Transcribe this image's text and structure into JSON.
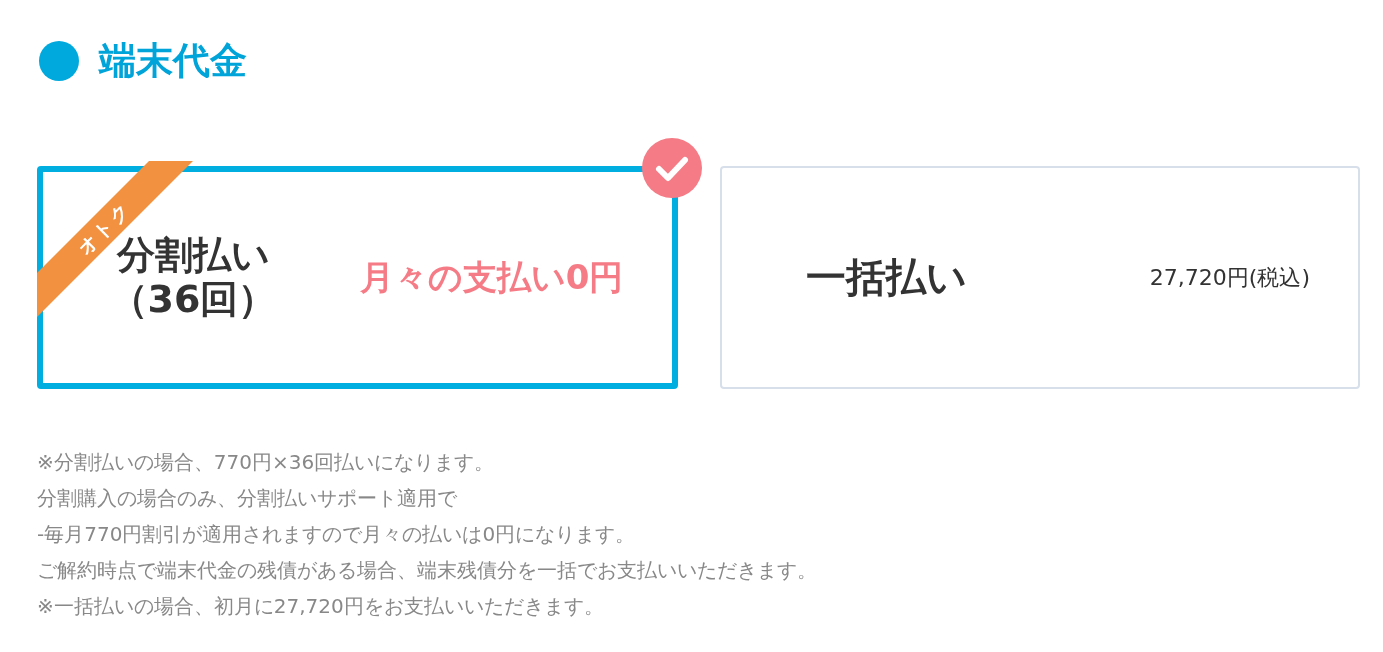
{
  "section": {
    "title": "端末代金"
  },
  "options": [
    {
      "label_lines": [
        "分割払い",
        "（36回）"
      ],
      "badge": "オトク",
      "price": "月々の支払い0円",
      "kind": "highlight",
      "selected": true
    },
    {
      "label_lines": [
        "一括払い"
      ],
      "price": "27,720円(税込)",
      "kind": "plain",
      "selected": false
    }
  ],
  "notes": [
    "※分割払いの場合、770円×36回払いになります。",
    "分割購入の場合のみ、分割払いサポート適用で",
    "‐毎月770円割引が適用されますので月々の払いは0円になります。",
    "ご解約時点で端末代金の残債がある場合、端末残債分を一括でお支払いいただきます。",
    "※一括払いの場合、初月に27,720円をお支払いいただきます。"
  ]
}
